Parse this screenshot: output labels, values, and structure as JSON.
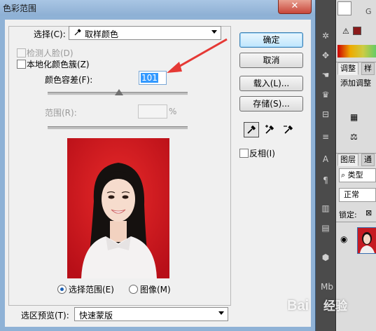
{
  "dialog": {
    "title": "色彩范围",
    "close_label": "✕",
    "select": {
      "label": "选择(C):",
      "value": "取样颜色"
    },
    "detect_faces": {
      "label": "检测人脸(D)",
      "checked": false,
      "enabled": false
    },
    "localized_clusters": {
      "label": "本地化颜色簇(Z)",
      "checked": false
    },
    "fuzziness": {
      "label": "颜色容差(F):",
      "value": "101",
      "slider_fraction": 0.5
    },
    "range": {
      "label": "范围(R):",
      "value": "",
      "unit": "%",
      "enabled": false
    },
    "selection_modes": [
      {
        "label": "选择范围(E)",
        "selected": true
      },
      {
        "label": "图像(M)",
        "selected": false
      }
    ],
    "preview_mode": {
      "label": "选区预览(T):",
      "value": "快速蒙版"
    },
    "buttons": {
      "ok": "确定",
      "cancel": "取消",
      "load": "载入(L)...",
      "save": "存储(S)..."
    },
    "invert": {
      "label": "反相(I)",
      "checked": false
    },
    "eyedroppers": [
      "eyedropper-icon",
      "eyedropper-plus-icon",
      "eyedropper-minus-icon"
    ],
    "annotation_arrow_color": "#e53935"
  },
  "photoshop": {
    "adjustments_tab": "调整",
    "styles_tab": "样",
    "add_adjustment_text": "添加调整",
    "layers_tab": "图层",
    "channels_tab": "通",
    "kind_label": "类型",
    "blend_mode": "正常",
    "lock_label": "锁定:",
    "swatch_color": "#8b1a1a"
  },
  "watermark": "Bai 经验"
}
